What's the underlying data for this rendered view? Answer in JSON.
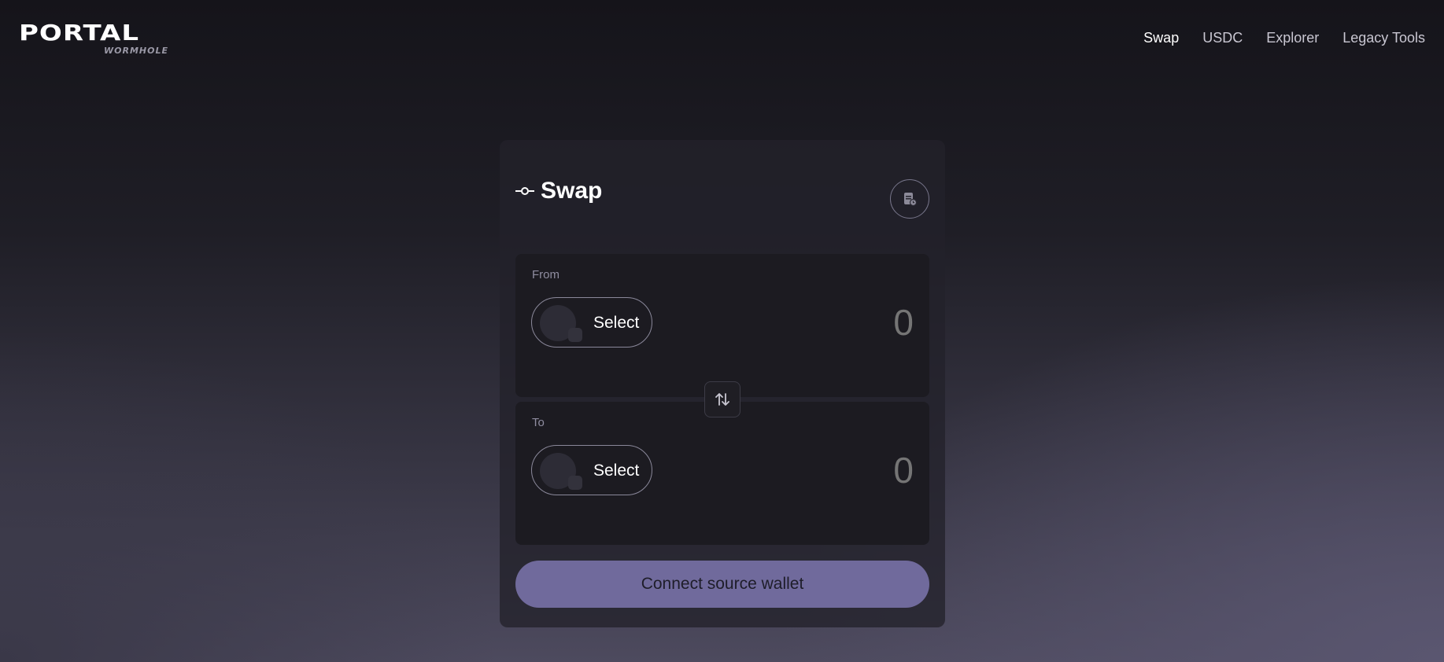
{
  "brand": {
    "name": "PORTAL",
    "sub": "WORMHOLE"
  },
  "nav": {
    "items": [
      {
        "label": "Swap",
        "active": true
      },
      {
        "label": "USDC",
        "active": false
      },
      {
        "label": "Explorer",
        "active": false
      },
      {
        "label": "Legacy Tools",
        "active": false
      }
    ]
  },
  "card": {
    "title": "Swap",
    "title_icon": "swap-commit-icon",
    "settings_icon": "transaction-history-icon"
  },
  "from": {
    "label": "From",
    "token_button": "Select",
    "amount": "0"
  },
  "to": {
    "label": "To",
    "token_button": "Select",
    "amount": "0"
  },
  "flip_icon": "swap-arrows-icon",
  "connect_button": "Connect source wallet",
  "colors": {
    "accent": "#706a9c",
    "panel": "#1c1b21",
    "card": "#22212a"
  }
}
